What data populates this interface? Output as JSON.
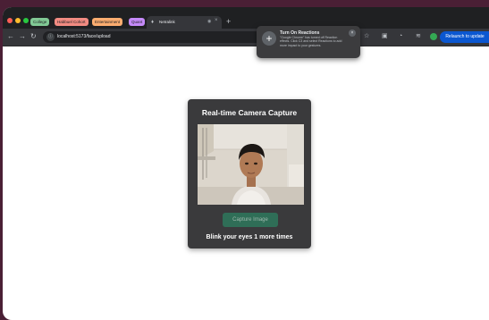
{
  "browser": {
    "tab_groups": [
      {
        "label": "College",
        "color": "#81c995"
      },
      {
        "label": "Habbuel Cohort",
        "color": "#f28b82"
      },
      {
        "label": "Entertainment",
        "color": "#fcad70"
      },
      {
        "label": "Quant",
        "color": "#c58af9"
      }
    ],
    "active_tab": {
      "title": "Netralink",
      "favicon": "tab-favicon-icon"
    },
    "new_tab_label": "+",
    "url": "localhost:5173/face/upload",
    "relaunch_label": "Relaunch to update",
    "nav_icons": [
      "back-icon",
      "forward-icon",
      "reload-icon"
    ]
  },
  "reactions_popup": {
    "title": "Turn On Reactions",
    "body": "\"Google Chrome\" has turned off Reaction effects. Click C3 and select Reactions to add more impact to your gestures."
  },
  "capture_card": {
    "title": "Real-time Camera Capture",
    "capture_button": "Capture Image",
    "status": "Blink your eyes 1 more times"
  },
  "colors": {
    "card_bg": "#3a3a3c",
    "button_bg": "#2f6e57",
    "accent_blue": "#0b57d0"
  }
}
